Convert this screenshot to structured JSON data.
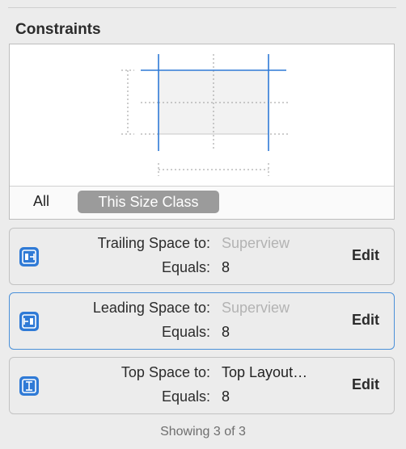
{
  "section": {
    "title": "Constraints"
  },
  "scope": {
    "all_label": "All",
    "size_class_label": "This Size Class"
  },
  "constraints": [
    {
      "name": "Trailing Space to:",
      "target": "Superview",
      "target_muted": true,
      "equals_label": "Equals:",
      "value": "8",
      "edit_label": "Edit",
      "icon": "trailing-space-icon",
      "selected": false
    },
    {
      "name": "Leading Space to:",
      "target": "Superview",
      "target_muted": true,
      "equals_label": "Equals:",
      "value": "8",
      "edit_label": "Edit",
      "icon": "leading-space-icon",
      "selected": true
    },
    {
      "name": "Top Space to:",
      "target": "Top Layout…",
      "target_muted": false,
      "equals_label": "Equals:",
      "value": "8",
      "edit_label": "Edit",
      "icon": "top-space-icon",
      "selected": false
    }
  ],
  "footer": {
    "status": "Showing 3 of 3"
  },
  "colors": {
    "accent": "#2f7ad6",
    "selection_border": "#4a90d9",
    "badge": "#9b9b9b"
  }
}
